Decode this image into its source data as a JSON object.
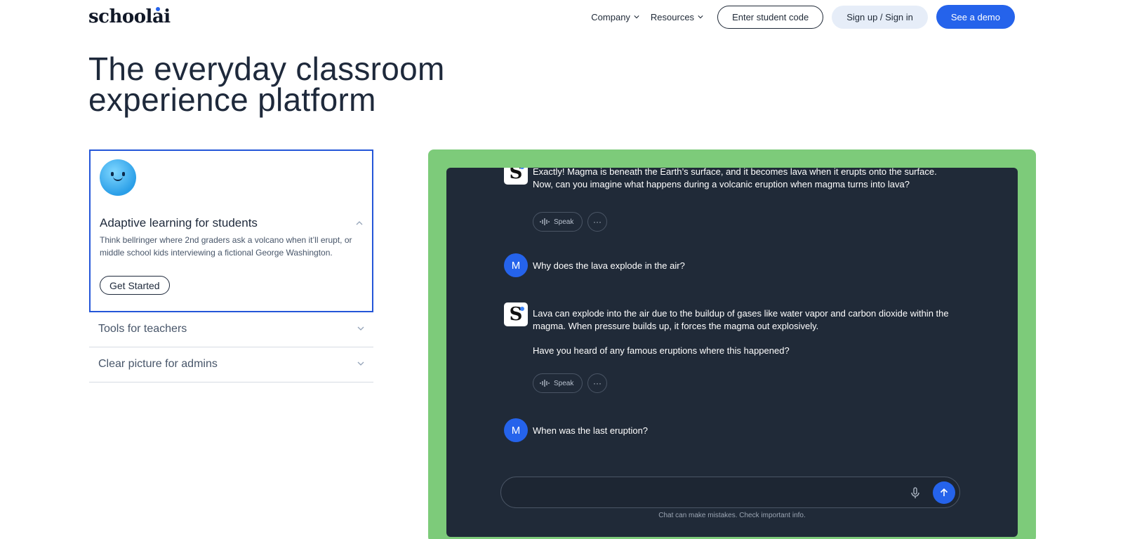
{
  "header": {
    "logo": "schoolai",
    "nav": [
      {
        "label": "Company"
      },
      {
        "label": "Resources"
      }
    ],
    "student_code_label": "Enter student code",
    "signin_label": "Sign up / Sign in",
    "demo_label": "See a demo"
  },
  "hero": {
    "line1": "The everyday classroom",
    "line2": "experience platform"
  },
  "accordion": {
    "open": {
      "title": "Adaptive learning for students",
      "description": "Think bellringer where 2nd graders ask a volcano when it’ll erupt, or middle school kids interviewing a fictional George Washington.",
      "cta": "Get Started"
    },
    "items": [
      {
        "label": "Tools for teachers"
      },
      {
        "label": "Clear picture for admins"
      }
    ]
  },
  "chat": {
    "user_initial": "M",
    "messages": [
      {
        "role": "assistant",
        "text": "Exactly! Magma is beneath the Earth’s surface, and it becomes lava when it erupts onto the surface. Now, can you imagine what happens during a volcanic eruption when magma turns into lava?"
      },
      {
        "role": "user",
        "text": "Why does the lava explode in the air?"
      },
      {
        "role": "assistant",
        "text": "Lava can explode into the air due to the buildup of gases like water vapor and carbon dioxide within the magma. When pressure builds up, it forces the magma out explosively.",
        "text2": "Have you heard of any famous eruptions where this happened?"
      },
      {
        "role": "user",
        "text": "When was the last eruption?"
      }
    ],
    "speak_label": "Speak",
    "more_label": "···",
    "disclaimer": "Chat can make mistakes. Check important info."
  },
  "colors": {
    "accent": "#2563eb",
    "panel_green": "#7dcb7a",
    "chat_bg": "#202a38"
  }
}
